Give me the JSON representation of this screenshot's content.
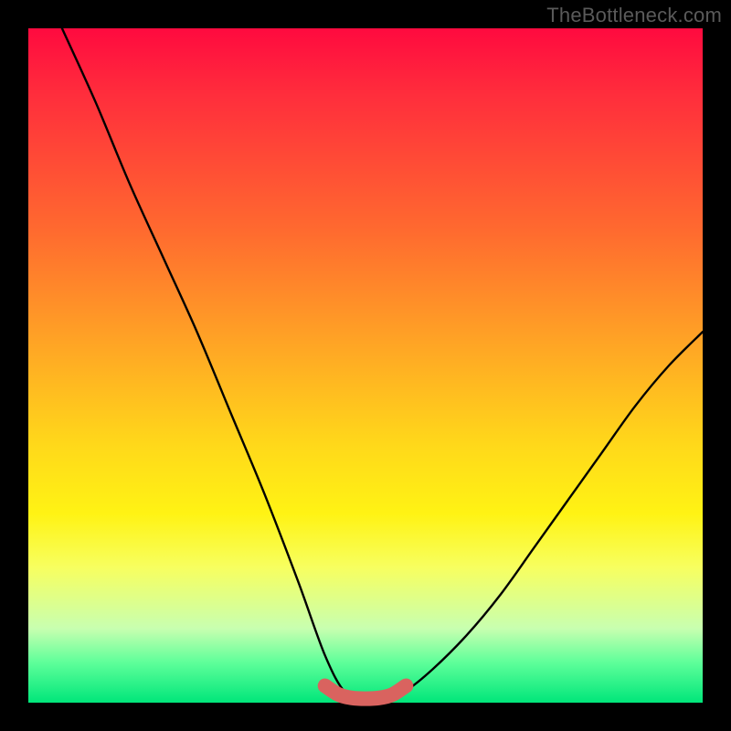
{
  "watermark": "TheBottleneck.com",
  "colors": {
    "background": "#000000",
    "curve": "#000000",
    "marker": "#d9635f",
    "gradient_top": "#ff0a3f",
    "gradient_bottom": "#00e67a"
  },
  "chart_data": {
    "type": "line",
    "title": "",
    "xlabel": "",
    "ylabel": "",
    "xlim": [
      0,
      100
    ],
    "ylim": [
      0,
      100
    ],
    "note": "No axes or tick labels are rendered. Values are normalized percentages read off the plot area. The left branch descends from (x≈5,y≈100) to a flat bottom segment near y≈0 between x≈45 and x≈55, then the right branch rises to (x≈100,y≈55). The pink marker traces the flat bottom.",
    "series": [
      {
        "name": "curve",
        "x": [
          5,
          10,
          15,
          20,
          25,
          30,
          35,
          40,
          44,
          47,
          50,
          53,
          56,
          60,
          65,
          70,
          75,
          80,
          85,
          90,
          95,
          100
        ],
        "y": [
          100,
          89,
          77,
          66,
          55,
          43,
          31,
          18,
          7,
          1.5,
          0.5,
          0.8,
          1.8,
          5,
          10,
          16,
          23,
          30,
          37,
          44,
          50,
          55
        ]
      },
      {
        "name": "bottom-marker",
        "x": [
          44,
          46,
          48,
          50,
          52,
          54,
          56
        ],
        "y": [
          2.5,
          1.2,
          0.7,
          0.6,
          0.7,
          1.2,
          2.5
        ]
      }
    ]
  }
}
